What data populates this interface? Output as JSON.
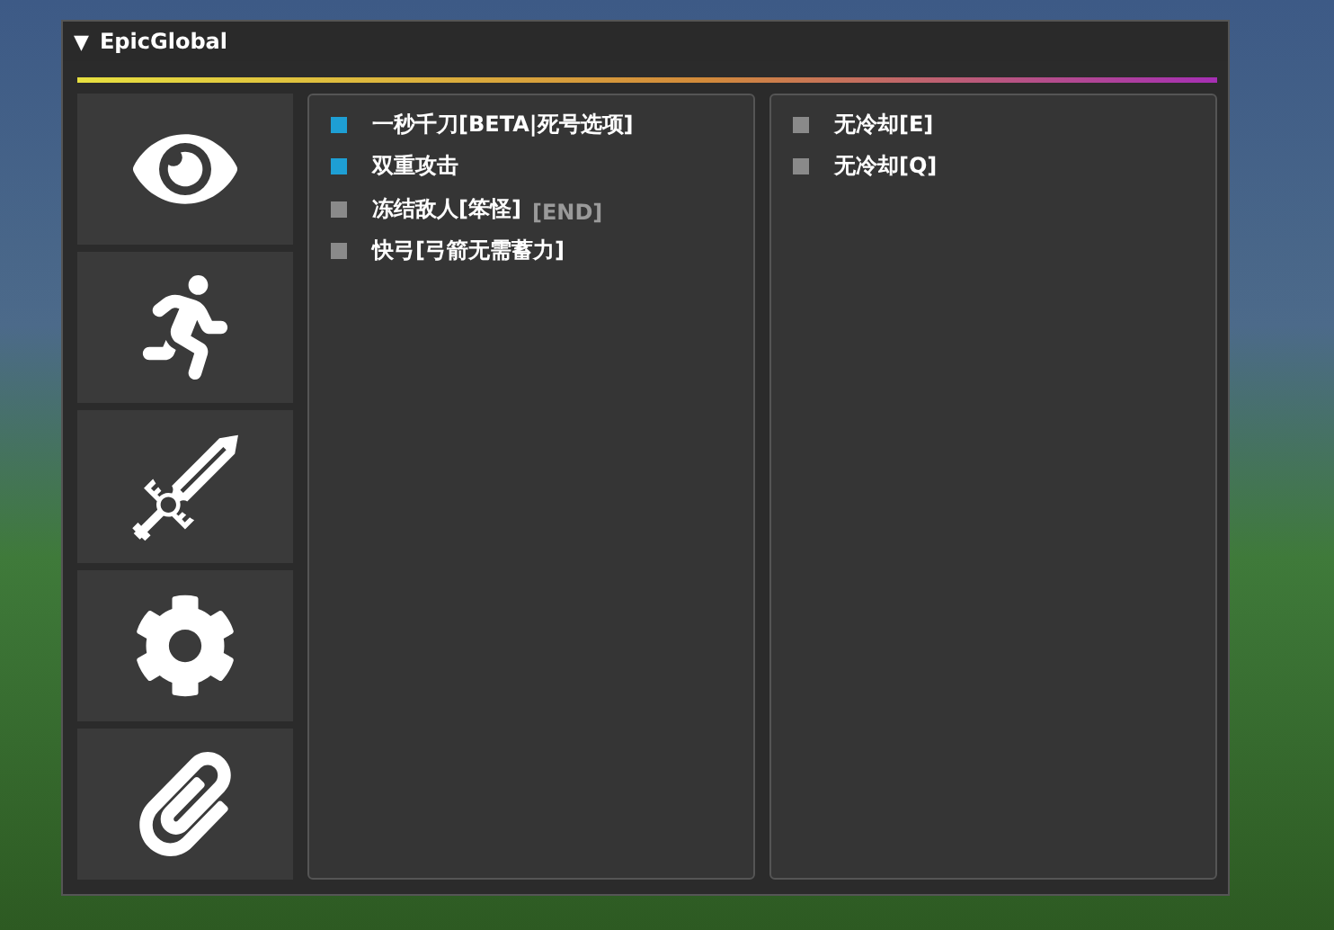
{
  "window": {
    "title": "EpicGlobal",
    "collapse_glyph": "▼"
  },
  "panels": [
    {
      "items": [
        {
          "label": "一秒千刀[BETA|死号选项]",
          "checked": true
        },
        {
          "label": "双重攻击",
          "checked": true
        },
        {
          "label": "冻结敌人[笨怪]",
          "checked": false,
          "hotkey": "[END]"
        },
        {
          "label": "快弓[弓箭无需蓄力]",
          "checked": false
        }
      ]
    },
    {
      "items": [
        {
          "label": "无冷却[E]",
          "checked": false
        },
        {
          "label": "无冷却[Q]",
          "checked": false
        }
      ]
    }
  ]
}
